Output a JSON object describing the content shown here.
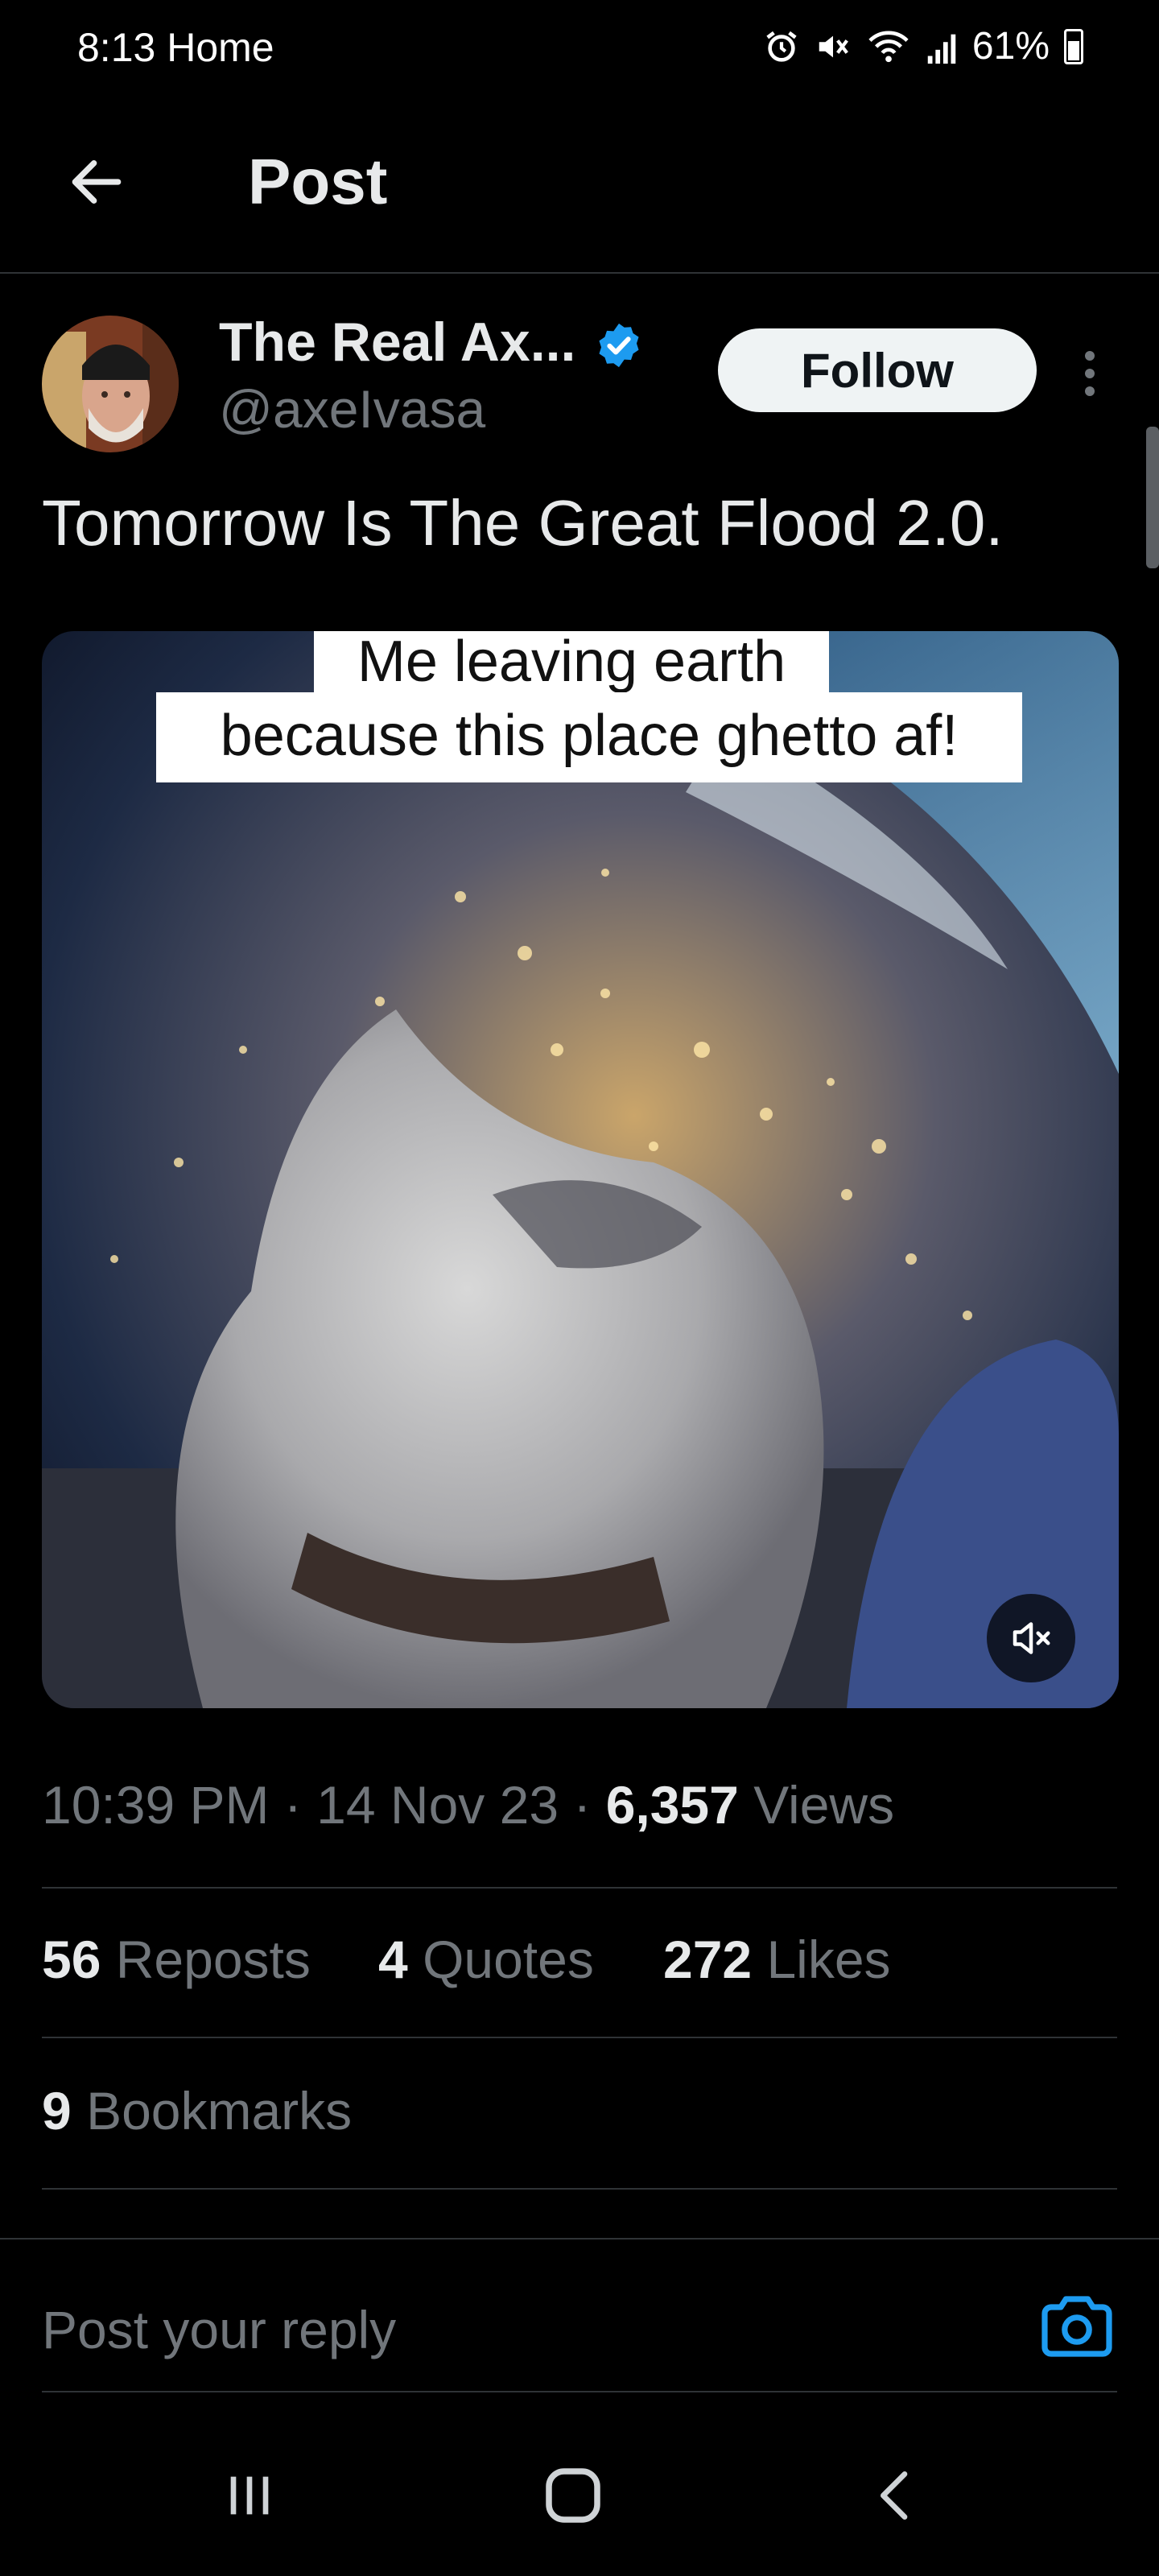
{
  "status_bar": {
    "time": "8:13",
    "location_label": "Home",
    "battery": "61%"
  },
  "header": {
    "title": "Post"
  },
  "post": {
    "author_name": "The Real Ax...",
    "handle": "@axeIvasa",
    "follow_label": "Follow",
    "text": "Tomorrow Is The Great Flood 2.0.",
    "media": {
      "caption_line1": "Me leaving earth",
      "caption_line2": "because this place ghetto af!"
    },
    "time": "10:39 PM",
    "date": "14 Nov 23",
    "views_count": "6,357",
    "views_label": "Views",
    "reposts_count": "56",
    "reposts_label": "Reposts",
    "quotes_count": "4",
    "quotes_label": "Quotes",
    "likes_count": "272",
    "likes_label": "Likes",
    "bookmarks_count": "9",
    "bookmarks_label": "Bookmarks"
  },
  "reply": {
    "placeholder": "Post your reply"
  },
  "colors": {
    "background": "#000000",
    "text_primary": "#e7e9ea",
    "text_secondary": "#71767b",
    "verified_blue": "#1d9bf0",
    "divider": "#2f3336"
  }
}
